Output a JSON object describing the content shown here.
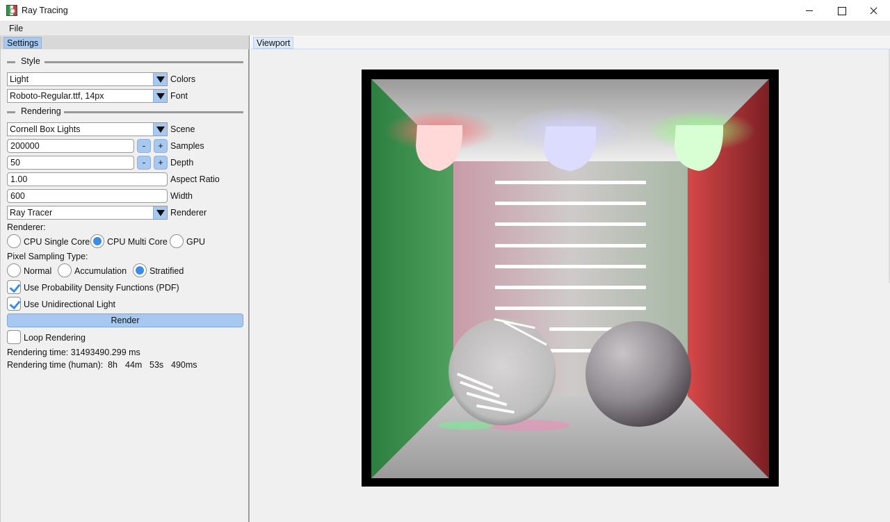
{
  "window": {
    "title": "Ray Tracing"
  },
  "menu": {
    "items": [
      "File"
    ]
  },
  "settings_panel": {
    "tab_label": "Settings",
    "style_section": "Style",
    "colors": {
      "value": "Light",
      "label": "Colors"
    },
    "font": {
      "value": "Roboto-Regular.ttf, 14px",
      "label": "Font"
    },
    "rendering_section": "Rendering",
    "scene": {
      "value": "Cornell Box Lights",
      "label": "Scene"
    },
    "samples": {
      "value": "200000",
      "label": "Samples",
      "minus": "-",
      "plus": "+"
    },
    "depth": {
      "value": "50",
      "label": "Depth",
      "minus": "-",
      "plus": "+"
    },
    "aspect_ratio": {
      "value": "1.00",
      "label": "Aspect Ratio"
    },
    "width": {
      "value": "600",
      "label": "Width"
    },
    "renderer": {
      "value": "Ray Tracer",
      "label": "Renderer"
    },
    "renderer_mode": {
      "heading": "Renderer:",
      "options": [
        "CPU Single Core",
        "CPU Multi Core",
        "GPU"
      ],
      "selected": "CPU Multi Core"
    },
    "pixel_sampling": {
      "heading": "Pixel Sampling Type:",
      "options": [
        "Normal",
        "Accumulation",
        "Stratified"
      ],
      "selected": "Stratified"
    },
    "use_pdf": {
      "label": "Use Probability Density Functions (PDF)",
      "checked": true
    },
    "use_unidirectional_light": {
      "label": "Use Unidirectional Light",
      "checked": true
    },
    "render_button": "Render",
    "loop_rendering": {
      "label": "Loop Rendering",
      "checked": false
    },
    "rendering_time": "Rendering time: 31493490.299 ms",
    "rendering_time_human": {
      "label": "Rendering time (human):",
      "hours": "8h",
      "minutes": "44m",
      "seconds": "53s",
      "milliseconds": "490ms"
    }
  },
  "viewport_panel": {
    "tab_label": "Viewport"
  },
  "colors": {
    "accent": "#a7c9f1",
    "selected": "#3c8ce7",
    "left_wall": "#2e9a43",
    "right_wall": "#d23a3a"
  }
}
